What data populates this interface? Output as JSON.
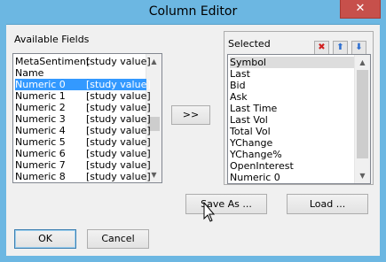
{
  "window": {
    "title": "Column Editor",
    "close_glyph": "✕"
  },
  "available": {
    "label": "Available Fields",
    "items": [
      {
        "name": "MetaSentiment",
        "type": "[study value]"
      },
      {
        "name": "Name",
        "type": ""
      },
      {
        "name": "Numeric 0",
        "type": "[study value]"
      },
      {
        "name": "Numeric 1",
        "type": "[study value]"
      },
      {
        "name": "Numeric 2",
        "type": "[study value]"
      },
      {
        "name": "Numeric 3",
        "type": "[study value]"
      },
      {
        "name": "Numeric 4",
        "type": "[study value]"
      },
      {
        "name": "Numeric 5",
        "type": "[study value]"
      },
      {
        "name": "Numeric 6",
        "type": "[study value]"
      },
      {
        "name": "Numeric 7",
        "type": "[study value]"
      },
      {
        "name": "Numeric 8",
        "type": "[study value]"
      }
    ],
    "selected_item": "Numeric 0"
  },
  "add_button": {
    "label": ">>"
  },
  "selected": {
    "label": "Selected",
    "items": [
      "Symbol",
      "Last",
      "Bid",
      "Ask",
      "Last Time",
      "Last Vol",
      "Total Vol",
      "YChange",
      "YChange%",
      "OpenInterest",
      "Numeric 0"
    ],
    "highlighted_item": "Symbol",
    "delete_icon": "red-x-icon",
    "up_icon": "arrow-up-icon",
    "down_icon": "arrow-down-icon"
  },
  "buttons": {
    "save_as": "Save As ...",
    "load": "Load ...",
    "ok": "OK",
    "cancel": "Cancel"
  },
  "colors": {
    "titlebar": "#6cb7e2",
    "selection": "#3399ff",
    "close": "#c7504b"
  }
}
